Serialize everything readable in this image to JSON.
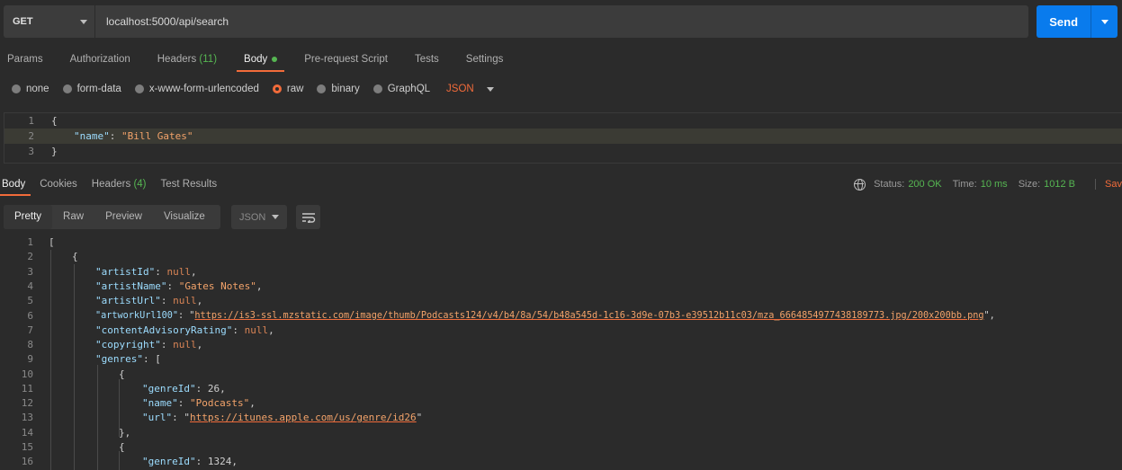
{
  "request": {
    "method": "GET",
    "url": "localhost:5000/api/search",
    "send_label": "Send"
  },
  "request_tabs": [
    {
      "label": "Params"
    },
    {
      "label": "Authorization"
    },
    {
      "label": "Headers",
      "count": "(11)"
    },
    {
      "label": "Body"
    },
    {
      "label": "Pre-request Script"
    },
    {
      "label": "Tests"
    },
    {
      "label": "Settings"
    }
  ],
  "body_types": [
    "none",
    "form-data",
    "x-www-form-urlencoded",
    "raw",
    "binary",
    "GraphQL"
  ],
  "body_language": "JSON",
  "request_body": {
    "line_numbers": [
      "1",
      "2",
      "3"
    ],
    "key": "\"name\"",
    "value": "\"Bill Gates\""
  },
  "response_tabs": [
    {
      "label": "Body"
    },
    {
      "label": "Cookies"
    },
    {
      "label": "Headers",
      "count": "(4)"
    },
    {
      "label": "Test Results"
    }
  ],
  "response_status": {
    "status_label": "Status:",
    "status_value": "200 OK",
    "time_label": "Time:",
    "time_value": "10 ms",
    "size_label": "Size:",
    "size_value": "1012 B",
    "save_label": "Sav"
  },
  "view_modes": [
    "Pretty",
    "Raw",
    "Preview",
    "Visualize"
  ],
  "response_format": "JSON",
  "response_body": {
    "line_numbers": [
      "1",
      "2",
      "3",
      "4",
      "5",
      "6",
      "7",
      "8",
      "9",
      "10",
      "11",
      "12",
      "13",
      "14",
      "15",
      "16"
    ],
    "artistId_key": "\"artistId\"",
    "artistName_key": "\"artistName\"",
    "artistName_value": "\"Gates Notes\"",
    "artistUrl_key": "\"artistUrl\"",
    "artworkUrl100_key": "\"artworkUrl100\"",
    "artworkUrl100_value": "https://is3-ssl.mzstatic.com/image/thumb/Podcasts124/v4/b4/8a/54/b48a545d-1c16-3d9e-07b3-e39512b11c03/mza_6664854977438189773.jpg/200x200bb.png",
    "contentAdvisoryRating_key": "\"contentAdvisoryRating\"",
    "copyright_key": "\"copyright\"",
    "genres_key": "\"genres\"",
    "genreId_key": "\"genreId\"",
    "genreId_value_1": "26",
    "name_key": "\"name\"",
    "name_value_1": "\"Podcasts\"",
    "url_key": "\"url\"",
    "url_value_1": "https://itunes.apple.com/us/genre/id26",
    "genreId_value_2": "1324",
    "null_literal": "null"
  },
  "colors": {
    "accent": "#f26b3a",
    "send_button": "#097bed",
    "success": "#56b652",
    "json_key": "#9cdcfe",
    "json_string": "#f3a36a"
  }
}
